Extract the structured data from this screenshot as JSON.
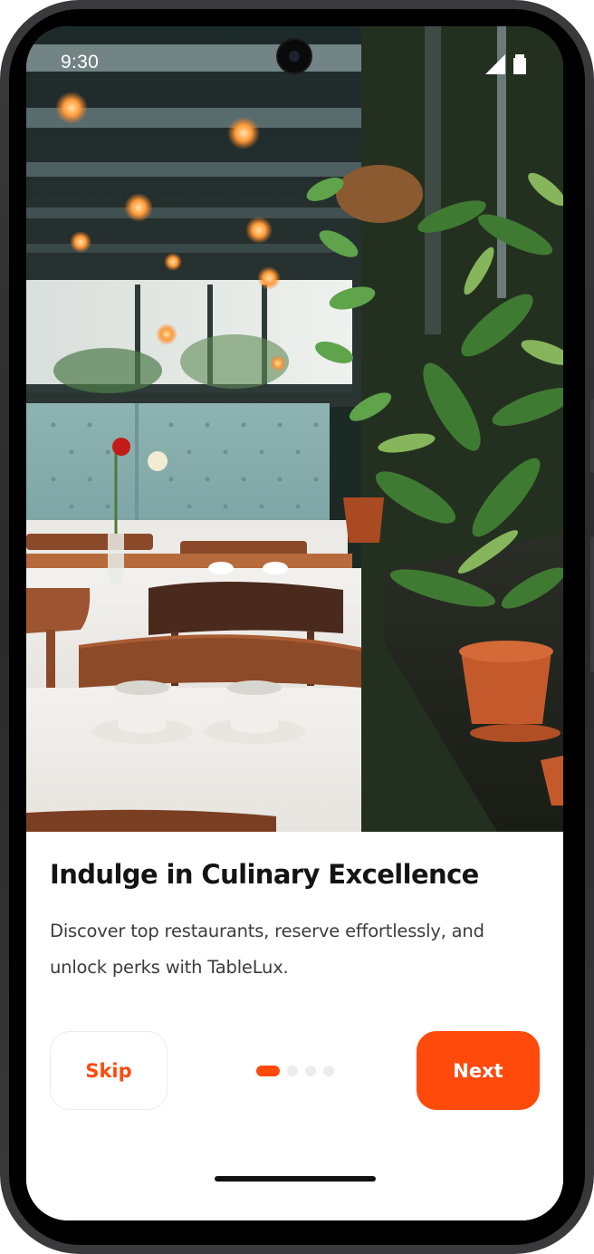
{
  "status_bar": {
    "time": "9:30",
    "icons": [
      "signal-icon",
      "battery-icon"
    ]
  },
  "hero_image": {
    "subject": "restaurant-interior-photo"
  },
  "onboarding": {
    "title": "Indulge in Culinary Excellence",
    "description": "Discover top restaurants, reserve effortlessly, and unlock perks with TableLux.",
    "skip_label": "Skip",
    "next_label": "Next",
    "page_indicator": {
      "current": 1,
      "total": 4
    }
  },
  "colors": {
    "accent": "#ff4a0c",
    "title_text": "#141414",
    "body_text": "#3c3c3c",
    "inactive_dot": "#ececec",
    "skip_border": "#ececec"
  }
}
